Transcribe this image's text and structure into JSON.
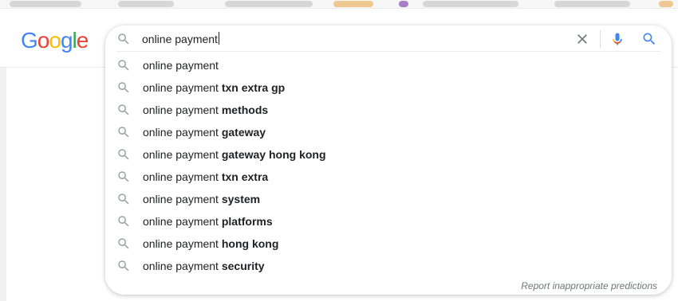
{
  "header": {
    "logo_letters": [
      {
        "ch": "G",
        "color": "#4285F4"
      },
      {
        "ch": "o",
        "color": "#EA4335"
      },
      {
        "ch": "o",
        "color": "#FBBC05"
      },
      {
        "ch": "g",
        "color": "#4285F4"
      },
      {
        "ch": "l",
        "color": "#34A853"
      },
      {
        "ch": "e",
        "color": "#EA4335"
      }
    ]
  },
  "search": {
    "query": "online payment",
    "clear_icon": "close-icon",
    "mic_icon": "microphone-icon",
    "search_icon": "search-icon",
    "accent_color": "#4285F4"
  },
  "suggestions": [
    {
      "base": "online payment",
      "completion": ""
    },
    {
      "base": "online payment ",
      "completion": "txn extra gp"
    },
    {
      "base": "online payment ",
      "completion": "methods"
    },
    {
      "base": "online payment ",
      "completion": "gateway"
    },
    {
      "base": "online payment ",
      "completion": "gateway hong kong"
    },
    {
      "base": "online payment ",
      "completion": "txn extra"
    },
    {
      "base": "online payment ",
      "completion": "system"
    },
    {
      "base": "online payment ",
      "completion": "platforms"
    },
    {
      "base": "online payment ",
      "completion": "hong kong"
    },
    {
      "base": "online payment ",
      "completion": "security"
    }
  ],
  "footer": {
    "report_label": "Report inappropriate predictions"
  }
}
